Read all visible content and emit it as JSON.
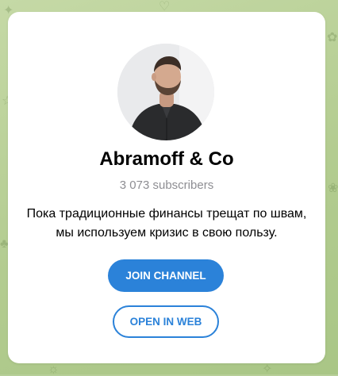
{
  "channel": {
    "title": "Abramoff & Co",
    "subscribers": "3 073 subscribers",
    "description_line1": "Пока традиционные финансы трещат по швам,",
    "description_line2": "мы используем кризис в свою пользу."
  },
  "buttons": {
    "join_label": "JOIN CHANNEL",
    "open_web_label": "OPEN IN WEB"
  },
  "colors": {
    "accent": "#2b82d9",
    "background": "#b7cf98",
    "card": "#ffffff",
    "muted_text": "#8e8e93"
  },
  "icons": {
    "background_pattern": "doodle-pattern"
  }
}
